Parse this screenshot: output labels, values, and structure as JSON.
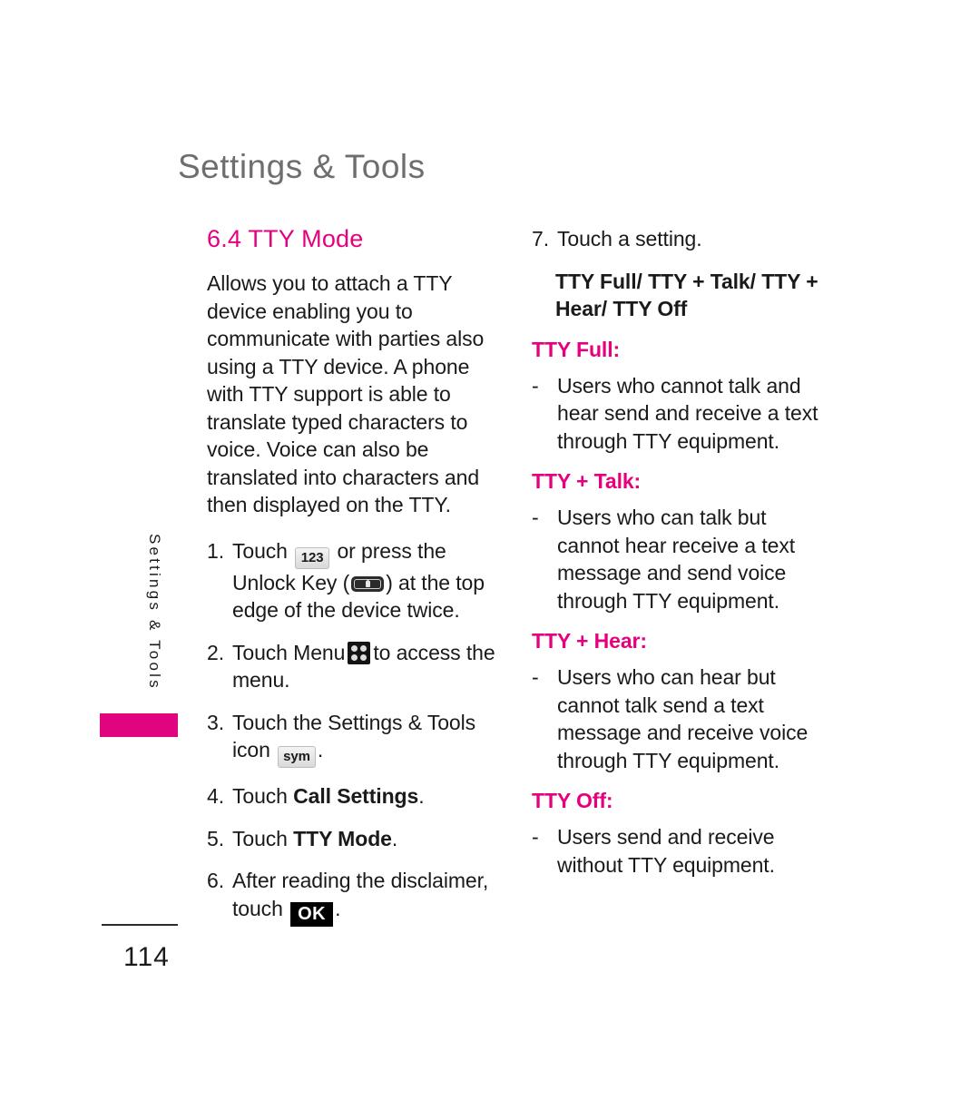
{
  "header": {
    "running_head": "Settings & Tools"
  },
  "side_tab": {
    "label": "Settings & Tools",
    "bar_color": "#e0047f"
  },
  "theme": {
    "accent_magenta": "#e6007e",
    "header_gray": "#6e6e6e"
  },
  "left_column": {
    "section_title": "6.4 TTY Mode",
    "intro": "Allows you to attach a TTY device enabling you to communicate with parties also using a TTY device. A phone with TTY support is able to translate typed characters to voice. Voice can also be translated into characters and then displayed on the TTY.",
    "steps": [
      {
        "num": "1.",
        "text_before": "Touch",
        "icon1": "numeric-key-icon",
        "icon1_label": "123",
        "text_mid": "or press the Unlock Key (",
        "icon2": "unlock-key-icon",
        "text_after": ") at the top edge of the device twice."
      },
      {
        "num": "2.",
        "text_before": "Touch Menu",
        "icon1": "menu-grid-icon",
        "text_after": "to access the menu."
      },
      {
        "num": "3.",
        "text_before": "Touch the Settings & Tools icon",
        "icon1": "sym-key-icon",
        "icon1_label": "sym",
        "text_after": "."
      },
      {
        "num": "4.",
        "text_before": "Touch",
        "bold_text": "Call Settings",
        "text_after": "."
      },
      {
        "num": "5.",
        "text_before": "Touch",
        "bold_text": "TTY Mode",
        "text_after": "."
      },
      {
        "num": "6.",
        "text_before": "After reading the disclaimer, touch",
        "icon1": "ok-button-icon",
        "icon1_label": "OK",
        "text_after": "."
      }
    ]
  },
  "right_column": {
    "step7": {
      "num": "7.",
      "text": "Touch a setting."
    },
    "options_heading": "TTY Full/ TTY + Talk/ TTY + Hear/ TTY Off",
    "definitions": [
      {
        "term": "TTY Full:",
        "dash": "-",
        "description": "Users who cannot  talk and hear send and receive a text through TTY equipment."
      },
      {
        "term": "TTY + Talk:",
        "dash": "-",
        "description": "Users who can talk but cannot hear receive a text message and send voice through TTY equipment."
      },
      {
        "term": "TTY + Hear:",
        "dash": "-",
        "description": "Users who can hear but cannot talk send a text message and receive voice through TTY equipment."
      },
      {
        "term": "TTY Off:",
        "dash": "-",
        "description": "Users send and receive without TTY equipment."
      }
    ]
  },
  "footer": {
    "page_number": "114"
  }
}
